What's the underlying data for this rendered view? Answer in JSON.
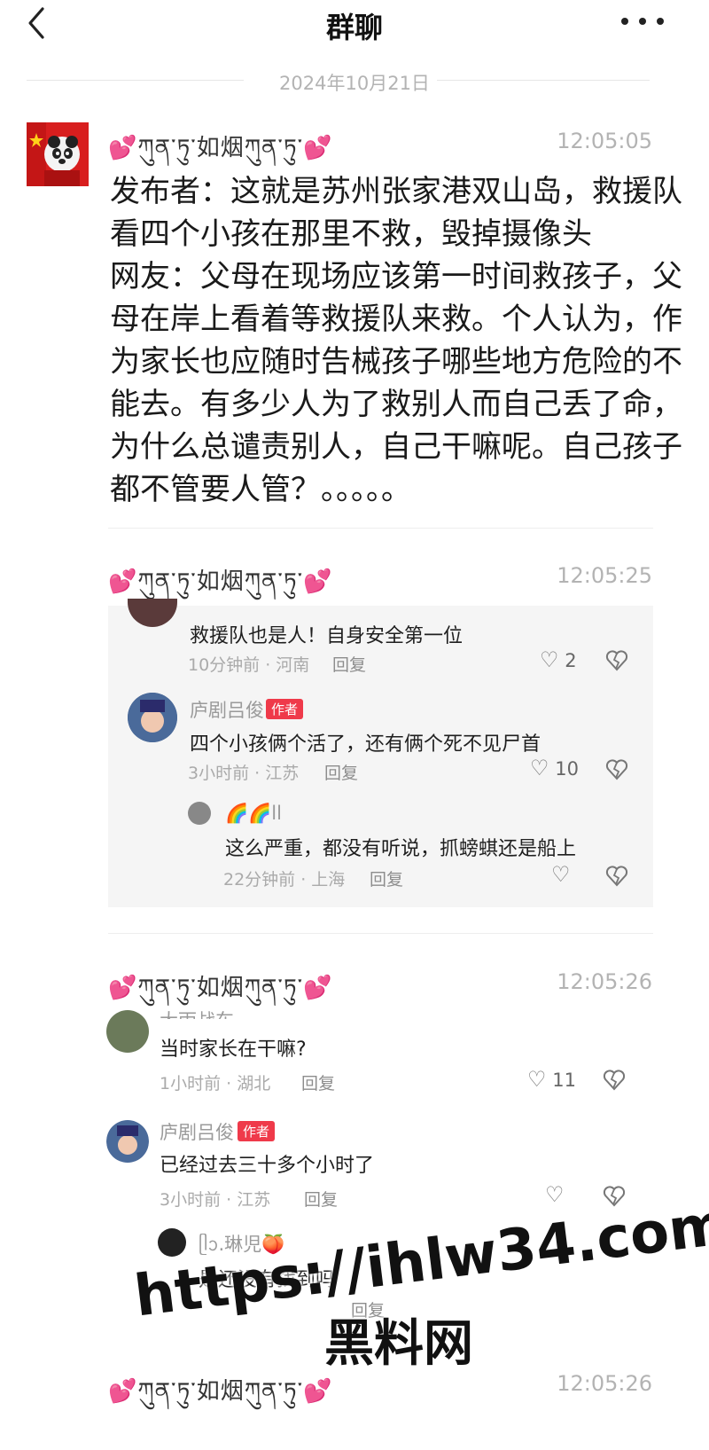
{
  "header": {
    "title": "群聊"
  },
  "date_divider": "2024年10月21日",
  "colors": {
    "heart": "#e04f9a",
    "author_tag": "#ef3a4a",
    "time": "#b3b3b3"
  },
  "messages": [
    {
      "sender": "💕ཀུན་ཏུ་如烟ཀུན་ཏུ་💕",
      "time": "12:05:05",
      "text": "发布者：这就是苏州张家港双山岛，救援队看四个小孩在那里不救，毁掉摄像头\n网友：父母在现场应该第一时间救孩子，父母在岸上看着等救援队来救。个人认为，作为家长也应随时告械孩子哪些地方危险的不能去。有多少人为了救别人而自己丢了命，为什么总谴责别人，自己干嘛呢。自己孩子都不管要人管？。。。。。"
    },
    {
      "sender": "💕ཀུན་ཏུ་如烟ཀུན་ཏུ་💕",
      "time": "12:05:25",
      "comments": [
        {
          "text": "救援队也是人！自身安全第一位",
          "meta": "10分钟前 · 河南",
          "reply": "回复",
          "likes": "2"
        },
        {
          "name": "庐剧吕俊",
          "tag": "作者",
          "text": "四个小孩俩个活了，还有俩个死不见尸首",
          "meta": "3小时前 · 江苏",
          "reply": "回复",
          "likes": "10"
        },
        {
          "name": "🌈🌈ll",
          "text": "这么严重，都没有听说，抓螃蜞还是船上",
          "meta": "22分钟前 · 上海",
          "reply": "回复",
          "likes": ""
        }
      ]
    },
    {
      "sender": "💕ཀུན་ཏུ་如烟ཀུན་ཏུ་💕",
      "time": "12:05:26",
      "comments": [
        {
          "name": "大雨战车",
          "text": "当时家长在干嘛?",
          "meta": "1小时前 · 湖北",
          "reply": "回复",
          "likes": "11"
        },
        {
          "name": "庐剧吕俊",
          "tag": "作者",
          "text": "已经过去三十多个小时了",
          "meta": "3小时前 · 江苏",
          "reply": "回复",
          "likes": ""
        },
        {
          "name": "ᥫᩣ.琳児🍑",
          "text": "是还没有找到吗",
          "meta": "",
          "reply": "回复",
          "likes": ""
        }
      ]
    },
    {
      "sender": "💕ཀུན་ཏུ་如烟ཀུན་ཏུ་💕",
      "time": "12:05:26"
    }
  ],
  "watermark": {
    "url": "https://ihlw34.com",
    "name": "黑料网"
  }
}
